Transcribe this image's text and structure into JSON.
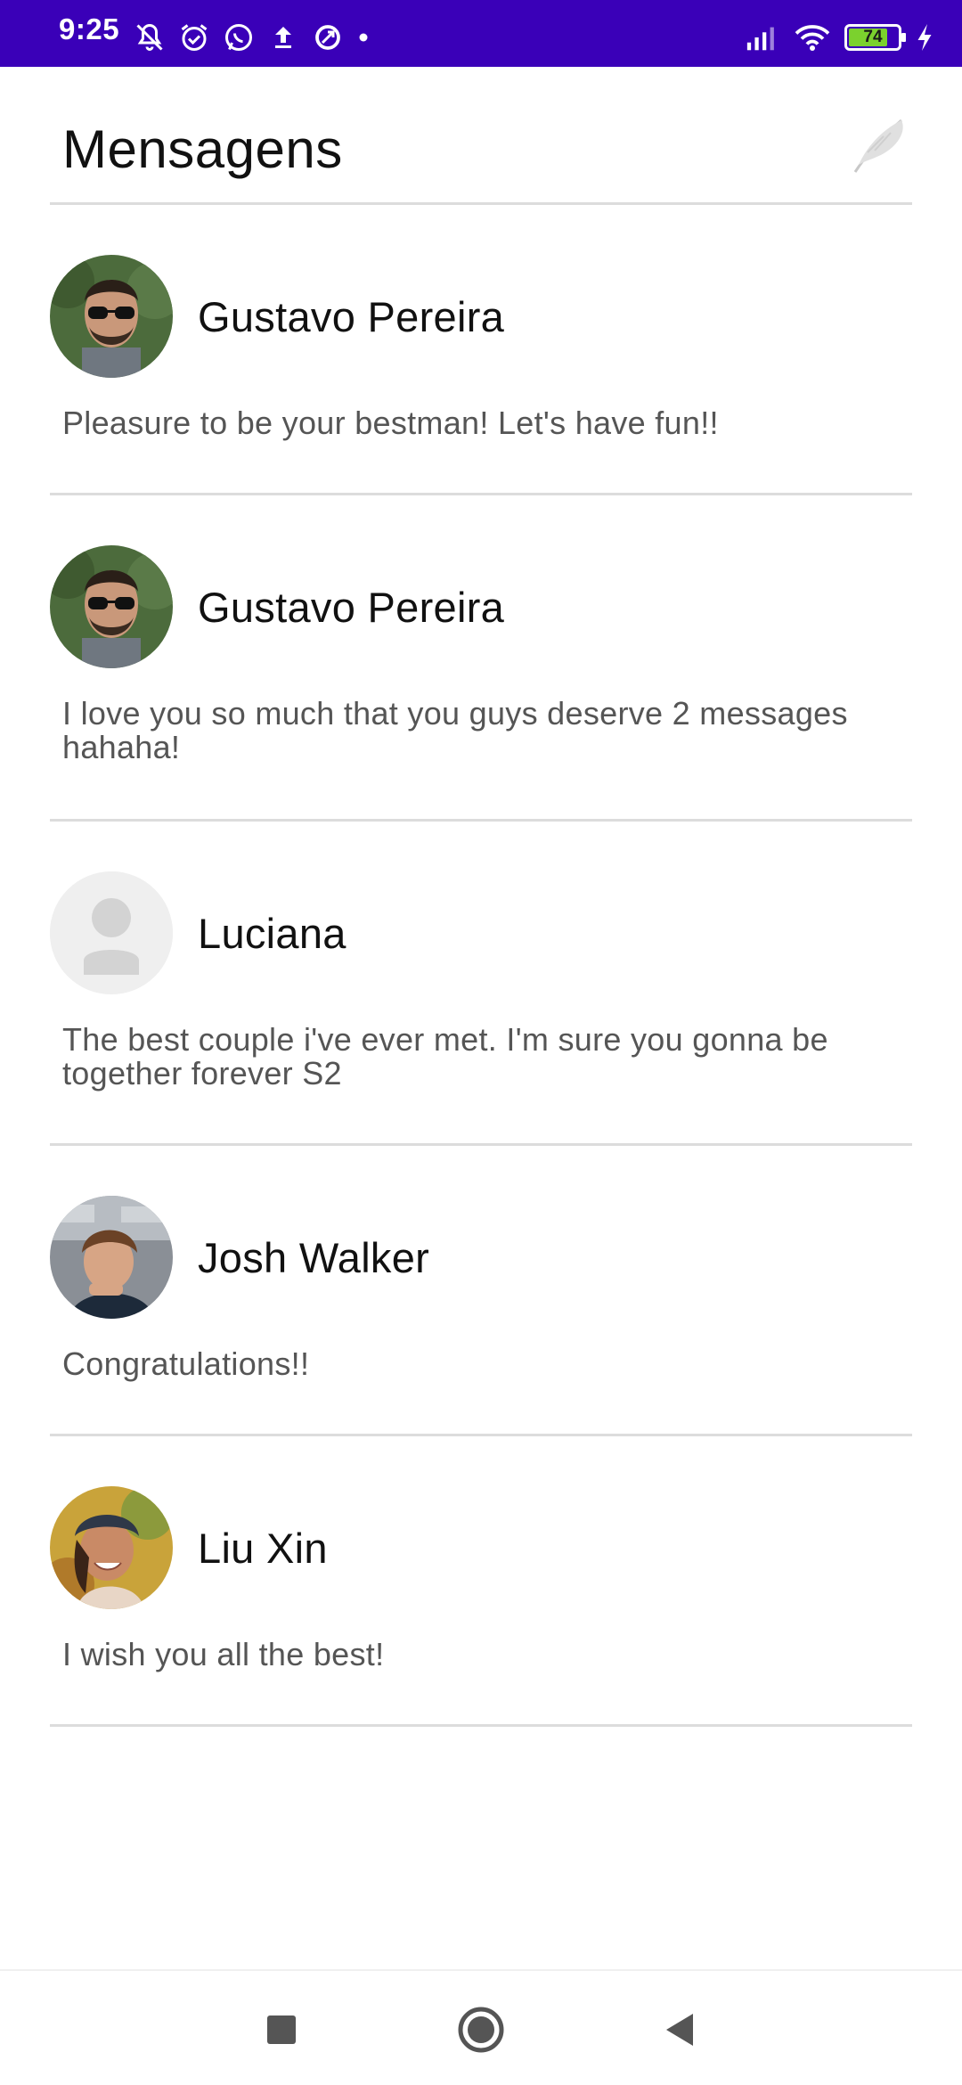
{
  "status_bar": {
    "time": "9:25",
    "battery": "74",
    "bg_color": "#3a00b8",
    "left_icons": [
      "notifications-off-icon",
      "alarm-icon",
      "whatsapp-icon",
      "upload-icon",
      "sync-icon",
      "dot-icon"
    ],
    "right_icons": [
      "signal-icon",
      "wifi-icon",
      "battery-icon",
      "charging-icon"
    ]
  },
  "header": {
    "title": "Mensagens",
    "compose_icon": "feather-icon"
  },
  "messages": [
    {
      "sender": "Gustavo Pereira",
      "text": "Pleasure to be your bestman! Let's have fun!!",
      "avatar": "photo"
    },
    {
      "sender": "Gustavo Pereira",
      "text": "I love you so much that you guys deserve 2 messages hahaha!",
      "avatar": "photo"
    },
    {
      "sender": "Luciana",
      "text": "The best couple i've ever met. I'm sure you gonna be together forever S2",
      "avatar": "placeholder"
    },
    {
      "sender": "Josh Walker",
      "text": "Congratulations!!",
      "avatar": "photo"
    },
    {
      "sender": "Liu Xin",
      "text": "I wish you all the best!",
      "avatar": "photo"
    }
  ],
  "nav_bar": {
    "buttons": [
      "recents-icon",
      "home-icon",
      "back-icon"
    ]
  }
}
